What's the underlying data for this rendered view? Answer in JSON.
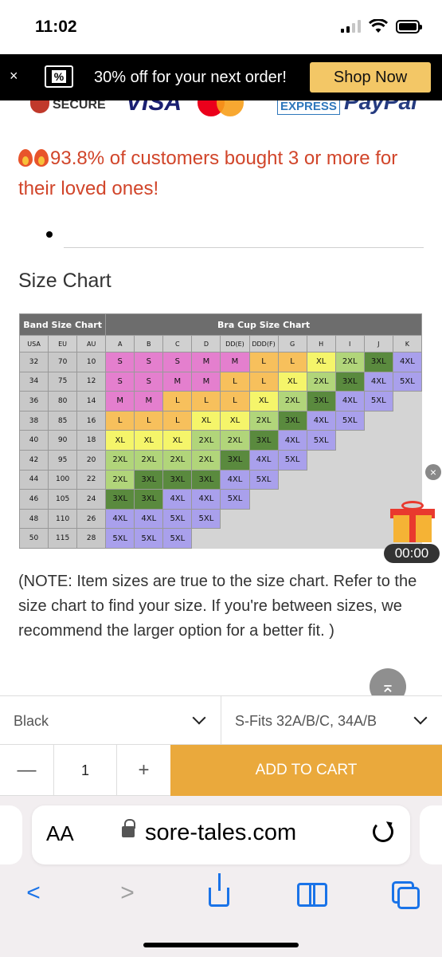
{
  "status_bar": {
    "time": "11:02"
  },
  "promo_banner": {
    "close_glyph": "×",
    "icon_label": "%",
    "text": "30% off for your next order!",
    "button_label": "Shop Now"
  },
  "payment_logos": {
    "secure": "SECURE",
    "visa": "VISA",
    "amex": "EXPRESS",
    "paypal": "PayPal"
  },
  "promo_line": "93.8% of customers bought 3 or more for their loved ones!",
  "section_title": "Size Chart",
  "size_chart": {
    "band_header": "Band Size Chart",
    "cup_header": "Bra Cup Size Chart",
    "band_columns": [
      "USA",
      "EU",
      "AU"
    ],
    "cup_columns": [
      "A",
      "B",
      "C",
      "D",
      "DD(E)",
      "DDD(F)",
      "G",
      "H",
      "I",
      "J",
      "K"
    ],
    "rows": [
      {
        "band": [
          "32",
          "70",
          "10"
        ],
        "sizes": [
          "S",
          "S",
          "S",
          "M",
          "M",
          "L",
          "L",
          "XL",
          "2XL",
          "3XL",
          "4XL"
        ]
      },
      {
        "band": [
          "34",
          "75",
          "12"
        ],
        "sizes": [
          "S",
          "S",
          "M",
          "M",
          "L",
          "L",
          "XL",
          "2XL",
          "3XL",
          "4XL",
          "5XL"
        ]
      },
      {
        "band": [
          "36",
          "80",
          "14"
        ],
        "sizes": [
          "M",
          "M",
          "L",
          "L",
          "L",
          "XL",
          "2XL",
          "3XL",
          "4XL",
          "5XL"
        ]
      },
      {
        "band": [
          "38",
          "85",
          "16"
        ],
        "sizes": [
          "L",
          "L",
          "L",
          "XL",
          "XL",
          "2XL",
          "3XL",
          "4XL",
          "5XL"
        ]
      },
      {
        "band": [
          "40",
          "90",
          "18"
        ],
        "sizes": [
          "XL",
          "XL",
          "XL",
          "2XL",
          "2XL",
          "3XL",
          "4XL",
          "5XL"
        ]
      },
      {
        "band": [
          "42",
          "95",
          "20"
        ],
        "sizes": [
          "2XL",
          "2XL",
          "2XL",
          "2XL",
          "3XL",
          "4XL",
          "5XL"
        ]
      },
      {
        "band": [
          "44",
          "100",
          "22"
        ],
        "sizes": [
          "2XL",
          "3XL",
          "3XL",
          "3XL",
          "4XL",
          "5XL"
        ]
      },
      {
        "band": [
          "46",
          "105",
          "24"
        ],
        "sizes": [
          "3XL",
          "3XL",
          "4XL",
          "4XL",
          "5XL"
        ]
      },
      {
        "band": [
          "48",
          "110",
          "26"
        ],
        "sizes": [
          "4XL",
          "4XL",
          "5XL",
          "5XL"
        ]
      },
      {
        "band": [
          "50",
          "115",
          "28"
        ],
        "sizes": [
          "5XL",
          "5XL",
          "5XL"
        ]
      }
    ]
  },
  "gift_widget": {
    "close_glyph": "×",
    "timer": "00:00"
  },
  "note": "(NOTE: Item sizes are true to the size chart. Refer to the size chart to find your size. If you're between sizes, we recommend the larger option for a better fit. )",
  "back_to_top_glyph": "⌅",
  "selectors": {
    "color_value": "Black",
    "size_value": "S-Fits 32A/B/C, 34A/B"
  },
  "quantity": {
    "minus": "—",
    "value": "1",
    "plus": "+"
  },
  "cart": {
    "label": "ADD TO CART"
  },
  "browser": {
    "aa_label": "AA",
    "url": "sore-tales.com",
    "back_glyph": "<",
    "forward_glyph": ">"
  },
  "colors": {
    "promo_text": "#d1452a",
    "cart_button": "#eaa93c",
    "shop_now": "#f3c766",
    "safari_blue": "#1a73e8"
  }
}
